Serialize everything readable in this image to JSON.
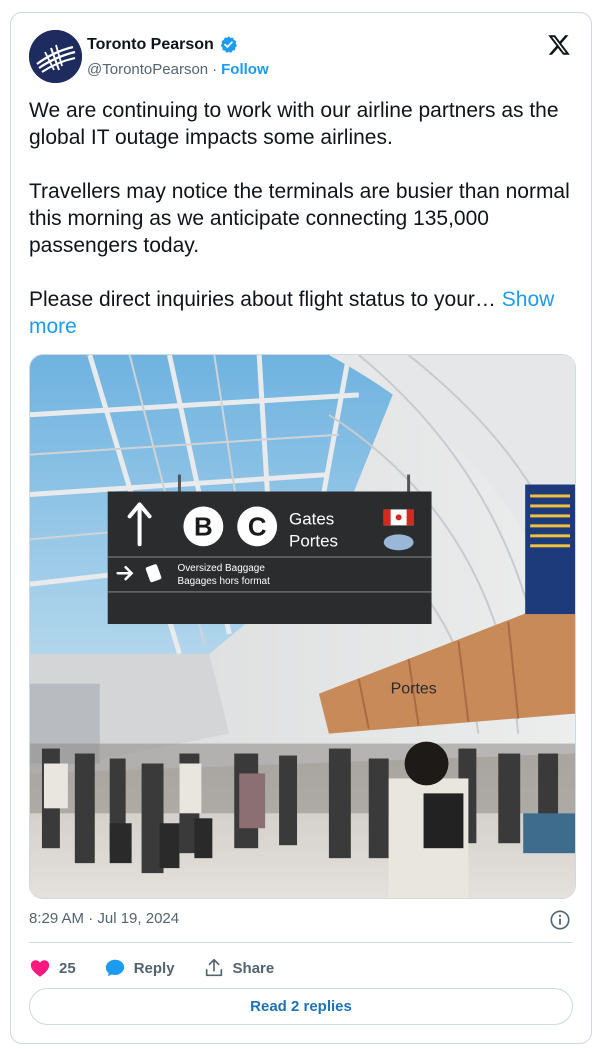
{
  "author": {
    "name": "Toronto Pearson",
    "handle": "@TorontoPearson",
    "separator": "·",
    "follow_label": "Follow"
  },
  "tweet": {
    "paragraph_1": "We are continuing to work with our airline partners as the global IT outage impacts some airlines.",
    "paragraph_2": "Travellers may notice the terminals are busier than normal this morning as we anticipate connecting 135,000 passengers today.",
    "paragraph_3": "Please direct inquiries about flight status to your…",
    "show_more": "Show more"
  },
  "photo": {
    "sign": {
      "gate_b": "B",
      "gate_c": "C",
      "gates_en": "Gates",
      "gates_fr": "Portes",
      "baggage_en": "Oversized Baggage",
      "baggage_fr": "Bagages hors format"
    },
    "wall_sign": "Portes"
  },
  "meta": {
    "timestamp": "8:29 AM · Jul 19, 2024"
  },
  "actions": {
    "likes": "25",
    "reply_label": "Reply",
    "share_label": "Share",
    "read_replies": "Read 2 replies"
  },
  "colors": {
    "accent": "#1d9bf0",
    "like": "#f91880",
    "muted": "#536471"
  },
  "icons": [
    "verified-badge-icon",
    "x-logo-icon",
    "info-icon",
    "heart-icon",
    "reply-bubble-icon",
    "share-icon"
  ]
}
